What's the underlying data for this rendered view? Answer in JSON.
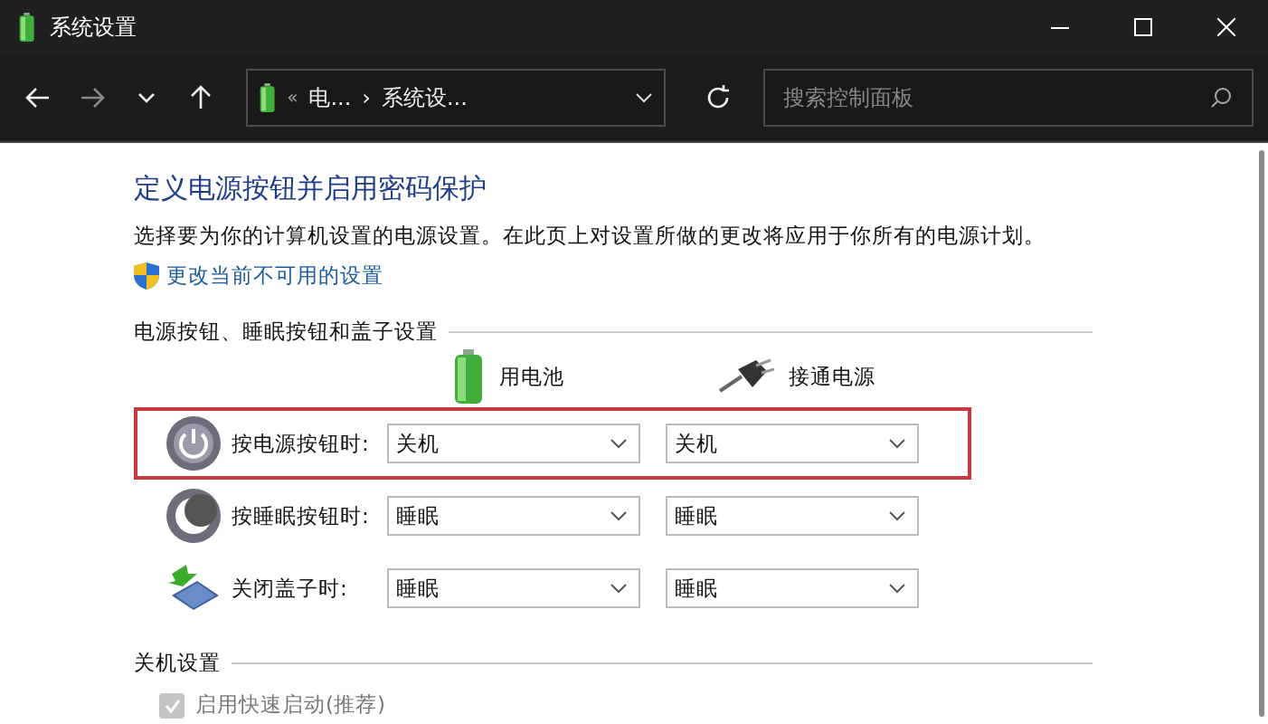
{
  "window": {
    "title": "系统设置"
  },
  "address_bar": {
    "segments": [
      "«",
      "电...",
      "›",
      "系统设..."
    ]
  },
  "search": {
    "placeholder": "搜索控制面板"
  },
  "page": {
    "heading": "定义电源按钮并启用密码保护",
    "description": "选择要为你的计算机设置的电源设置。在此页上对设置所做的更改将应用于你所有的电源计划。",
    "admin_link": "更改当前不可用的设置"
  },
  "buttons_section": {
    "title": "电源按钮、睡眠按钮和盖子设置",
    "columns": [
      {
        "kind": "battery",
        "label": "用电池"
      },
      {
        "kind": "plug",
        "label": "接通电源"
      }
    ],
    "rows": [
      {
        "kind": "power",
        "label": "按电源按钮时:",
        "battery": "关机",
        "plugged": "关机",
        "highlighted": true
      },
      {
        "kind": "sleep",
        "label": "按睡眠按钮时:",
        "battery": "睡眠",
        "plugged": "睡眠",
        "highlighted": false
      },
      {
        "kind": "lid",
        "label": "关闭盖子时:",
        "battery": "睡眠",
        "plugged": "睡眠",
        "highlighted": false
      }
    ]
  },
  "shutdown_section": {
    "title": "关机设置",
    "options": [
      {
        "label": "启用快速启动(推荐)",
        "checked": true,
        "disabled": true
      }
    ]
  }
}
